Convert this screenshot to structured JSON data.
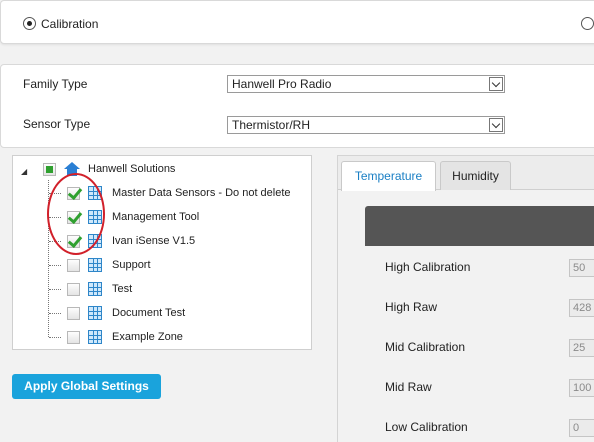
{
  "mode": {
    "selected_label": "Calibration"
  },
  "family_type": {
    "label": "Family Type",
    "value": "Hanwell Pro Radio"
  },
  "sensor_type": {
    "label": "Sensor Type",
    "value": "Thermistor/RH"
  },
  "tree": {
    "root": {
      "label": "Hanwell Solutions",
      "state": "partial",
      "icon": "home-icon"
    },
    "children": [
      {
        "label": "Master Data Sensors - Do not delete",
        "state": "checked",
        "icon": "grid-icon"
      },
      {
        "label": "Management Tool",
        "state": "checked",
        "icon": "grid-icon"
      },
      {
        "label": "Ivan iSense V1.5",
        "state": "checked",
        "icon": "grid-icon"
      },
      {
        "label": "Support",
        "state": "unchecked",
        "icon": "grid-icon"
      },
      {
        "label": "Test",
        "state": "unchecked",
        "icon": "grid-icon"
      },
      {
        "label": "Document Test",
        "state": "unchecked",
        "icon": "grid-icon"
      },
      {
        "label": "Example Zone",
        "state": "unchecked",
        "icon": "grid-icon"
      }
    ]
  },
  "apply_button": {
    "label": "Apply Global Settings"
  },
  "tabs": [
    {
      "label": "Temperature",
      "active": true
    },
    {
      "label": "Humidity",
      "active": false
    }
  ],
  "calibration": {
    "rows": [
      {
        "label": "High Calibration",
        "value": "50"
      },
      {
        "label": "High Raw",
        "value": "428"
      },
      {
        "label": "Mid Calibration",
        "value": "25"
      },
      {
        "label": "Mid Raw",
        "value": "100"
      },
      {
        "label": "Low Calibration",
        "value": "0"
      }
    ]
  },
  "colors": {
    "accent": "#1aa3dc",
    "check_green": "#2fa02f",
    "annotation_red": "#d1202a"
  }
}
